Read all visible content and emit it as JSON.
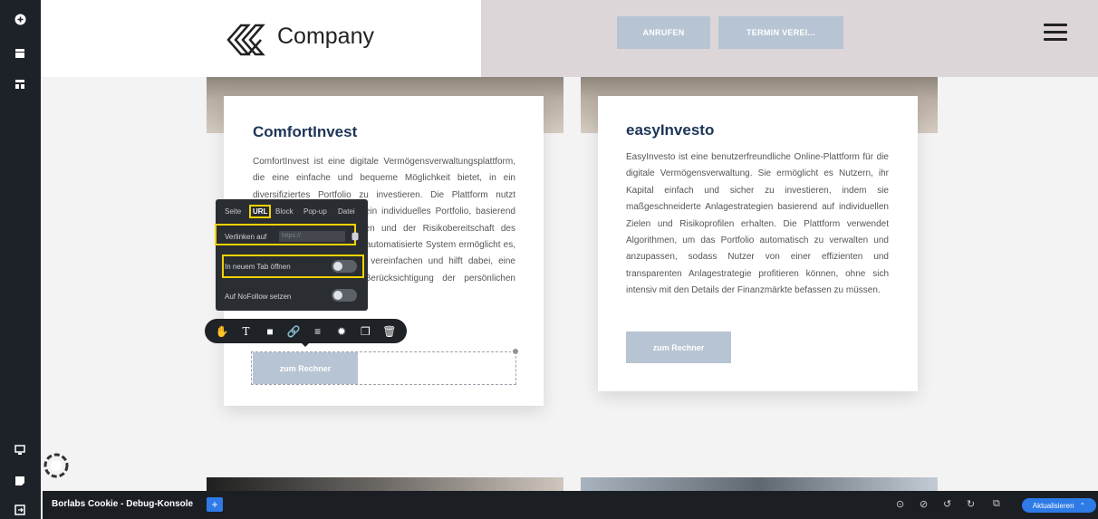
{
  "header": {
    "logo_text": "Company",
    "call_button": "ANRUFEN",
    "appointment_button": "TERMIN VEREI..."
  },
  "cards": [
    {
      "title": "ComfortInvest",
      "text": "ComfortInvest ist eine digitale Vermögensverwaltungsplattform, die eine einfache und bequeme Möglichkeit bietet, in ein diversifiziertes Portfolio zu investieren. Die Plattform nutzt moderne Algorithmen, um ein individuelles Portfolio, basierend auf den individuellen Zielen und der Risikobereitschaft des Nutzers zu entwickeln. Das automatisierte System ermöglicht es, den Investitionsprozess zu vereinfachen und hilft dabei, eine optimale Rendite unter Berücksichtigung der persönlichen Präferenzen zu erzielen.",
      "button": "zum Rechner"
    },
    {
      "title": "easyInvesto",
      "text": "EasyInvesto ist eine benutzerfreundliche Online-Plattform für die digitale Vermögensverwaltung. Sie ermöglicht es Nutzern, ihr Kapital einfach und sicher zu investieren, indem sie maßgeschneiderte Anlagestrategien basierend auf individuellen Zielen und Risikoprofilen erhalten. Die Plattform verwendet Algorithmen, um das Portfolio automatisch zu verwalten und anzupassen, sodass Nutzer von einer effizienten und transparenten Anlagestrategie profitieren können, ohne sich intensiv mit den Details der Finanzmärkte befassen zu müssen.",
      "button": "zum Rechner"
    }
  ],
  "link_popover": {
    "tabs": [
      "Seite",
      "URL",
      "Block",
      "Pop-up",
      "Datei"
    ],
    "active_tab": "URL",
    "link_to_label": "Verlinken auf",
    "url_placeholder": "https://",
    "new_tab_label": "In neuem Tab öffnen",
    "nofollow_label": "Auf NoFollow setzen",
    "new_tab_on": false,
    "nofollow_on": false
  },
  "toolbar_icons": [
    "hand-icon",
    "text-icon",
    "square-icon",
    "link-icon",
    "align-icon",
    "gear-icon",
    "copy-icon",
    "trash-icon"
  ],
  "debug_bar": {
    "title": "Borlabs Cookie - Debug-Konsole",
    "plus": "+",
    "update_button": "Aktualisieren"
  },
  "colors": {
    "button_blue_gray": "#b7c4d3",
    "title_navy": "#1d3557",
    "highlight_yellow": "#f2d200",
    "accent_blue": "#2e7ae6"
  }
}
